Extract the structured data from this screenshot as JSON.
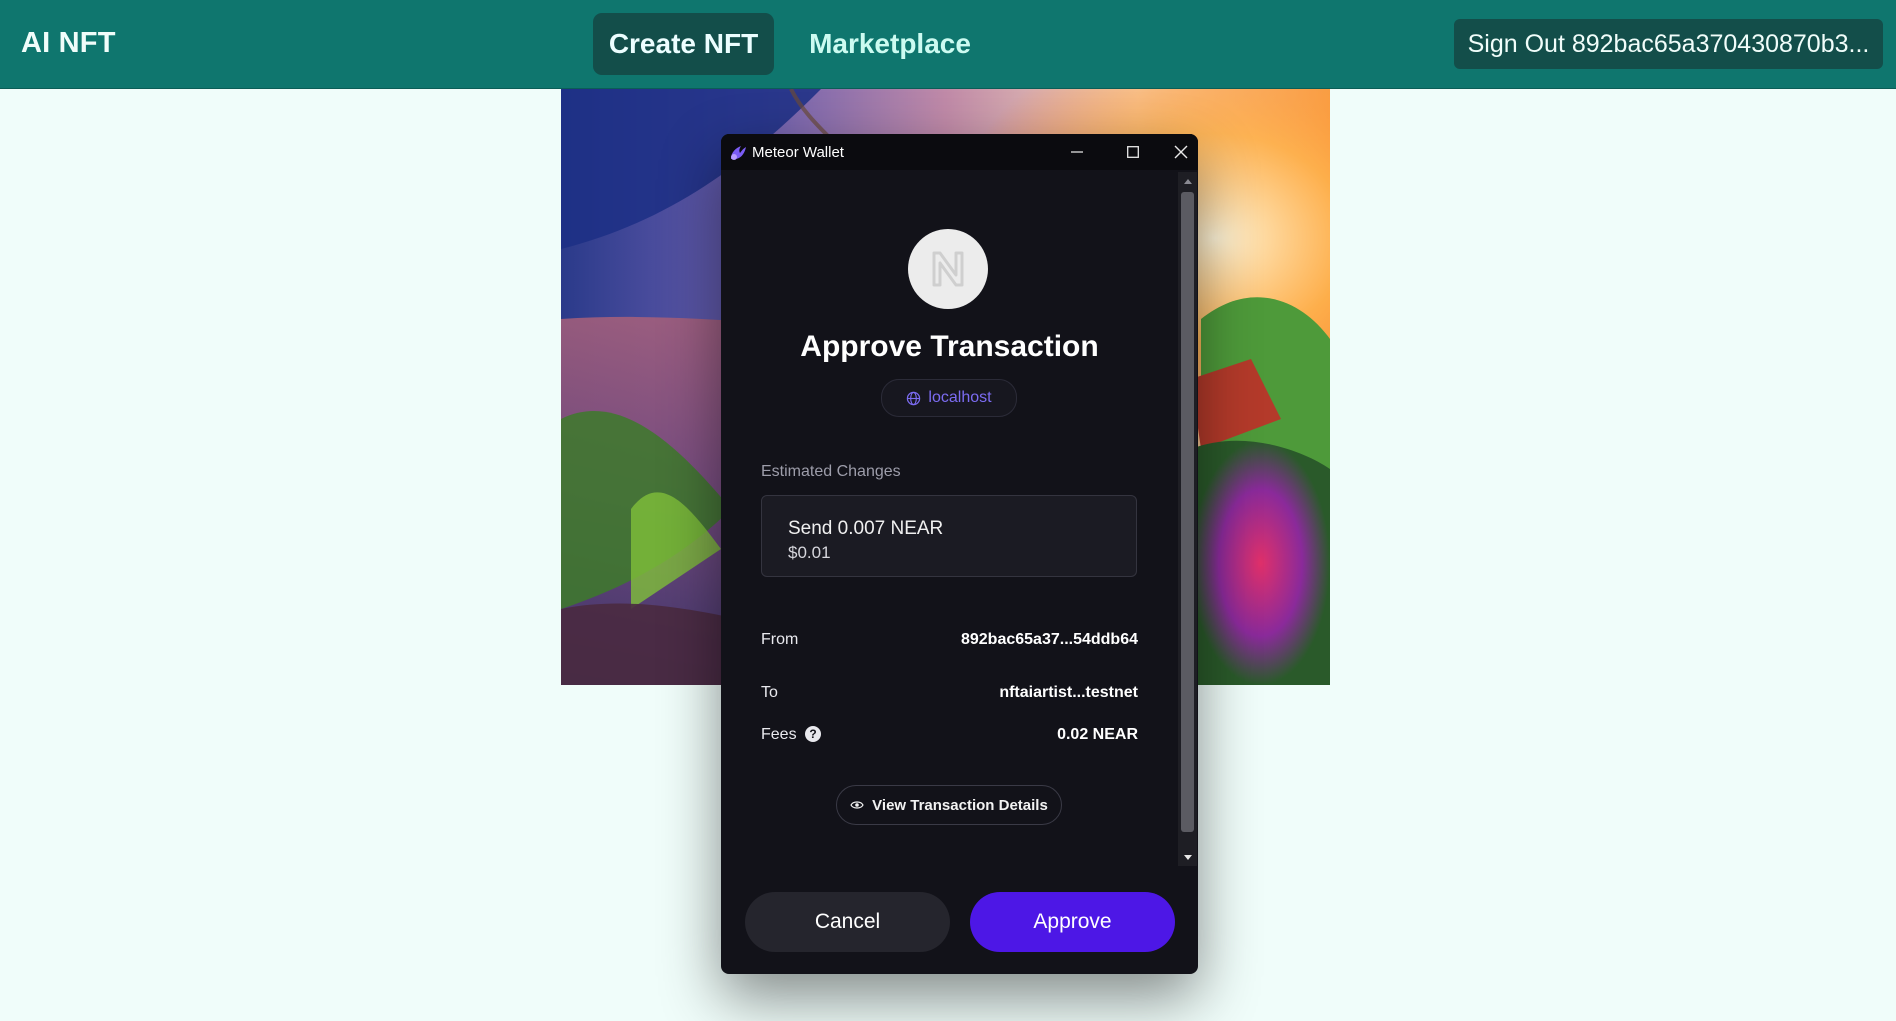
{
  "nav": {
    "brand": "AI NFT",
    "create_label": "Create NFT",
    "marketplace_label": "Marketplace",
    "signout_label": "Sign Out 892bac65a370430870b3..."
  },
  "artwork": {
    "icon": "generated-landscape-image"
  },
  "wallet": {
    "window_title": "Meteor Wallet",
    "app_icon": "meteor-icon",
    "title": "Approve Transaction",
    "origin": "localhost",
    "estimated_label": "Estimated Changes",
    "change_main": "Send 0.007 NEAR",
    "change_sub": "$0.01",
    "from_label": "From",
    "from_value": "892bac65a37...54ddb64",
    "to_label": "To",
    "to_value": "nftaiartist...testnet",
    "fees_label": "Fees",
    "fees_value": "0.02 NEAR",
    "details_label": "View Transaction Details",
    "cancel_label": "Cancel",
    "approve_label": "Approve"
  },
  "colors": {
    "nav_bg": "#0f766e",
    "page_bg": "#f0fdfa",
    "wallet_bg": "#121219",
    "approve_bg": "#4d17e6",
    "origin_text": "#7c6cf2"
  }
}
